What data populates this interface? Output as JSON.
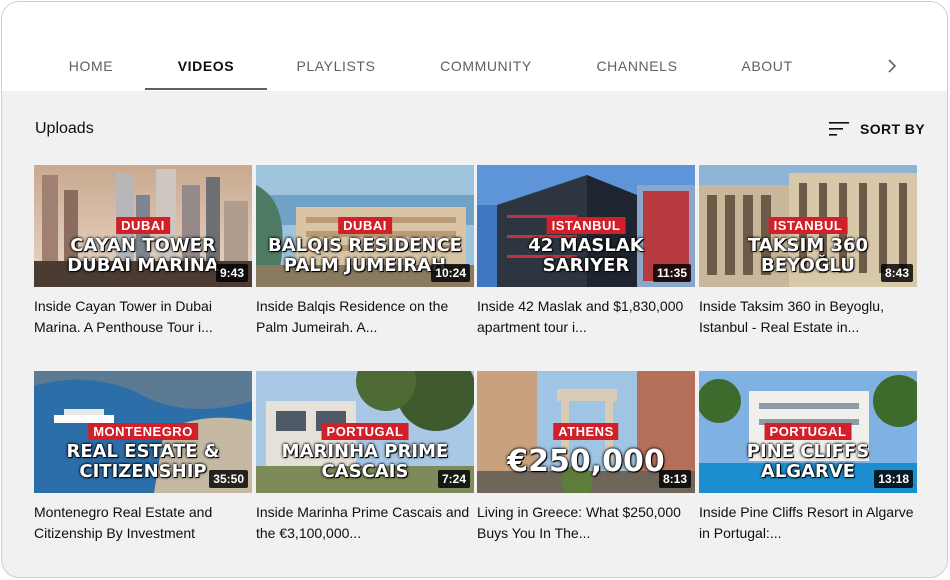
{
  "tabs": [
    {
      "label": "HOME"
    },
    {
      "label": "VIDEOS"
    },
    {
      "label": "PLAYLISTS"
    },
    {
      "label": "COMMUNITY"
    },
    {
      "label": "CHANNELS"
    },
    {
      "label": "ABOUT"
    }
  ],
  "active_tab": "VIDEOS",
  "section": {
    "title": "Uploads",
    "sort_label": "SORT BY"
  },
  "videos": [
    {
      "tag": "DUBAI",
      "headline": "CAYAN TOWER\nDUBAI MARINA",
      "duration": "9:43",
      "title": "Inside Cayan Tower in Dubai Marina. A Penthouse Tour i..."
    },
    {
      "tag": "DUBAI",
      "headline": "BALQIS RESIDENCE\nPALM JUMEIRAH",
      "duration": "10:24",
      "title": "Inside Balqis Residence on the Palm Jumeirah. A..."
    },
    {
      "tag": "ISTANBUL",
      "headline": "42 MASLAK\nSARIYER",
      "duration": "11:35",
      "title": "Inside 42 Maslak and $1,830,000 apartment tour i..."
    },
    {
      "tag": "ISTANBUL",
      "headline": "TAKSIM 360\nBEYOĞLU",
      "duration": "8:43",
      "title": "Inside Taksim 360 in Beyoglu, Istanbul - Real Estate in..."
    },
    {
      "tag": "MONTENEGRO",
      "headline": "REAL ESTATE &\nCITIZENSHIP",
      "duration": "35:50",
      "title": "Montenegro Real Estate and Citizenship By Investment"
    },
    {
      "tag": "PORTUGAL",
      "headline": "MARINHA PRIME\nCASCAIS",
      "duration": "7:24",
      "title": "Inside Marinha Prime Cascais and the €3,100,000..."
    },
    {
      "tag": "ATHENS",
      "headline": "€250,000",
      "duration": "8:13",
      "title": "Living in Greece: What $250,000 Buys You In The..."
    },
    {
      "tag": "PORTUGAL",
      "headline": "PINE CLIFFS\nALGARVE",
      "duration": "13:18",
      "title": "Inside Pine Cliffs Resort in Algarve in Portugal:..."
    }
  ]
}
